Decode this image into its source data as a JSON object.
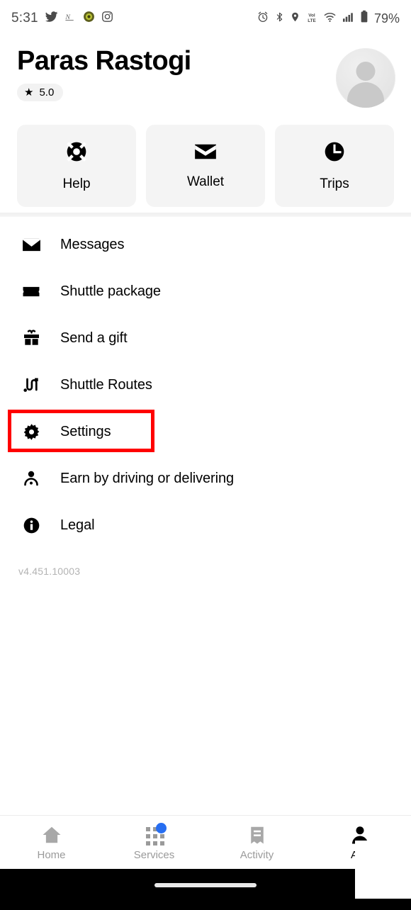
{
  "statusbar": {
    "time": "5:31",
    "battery_percent": "79%",
    "left_icons": [
      "twitter-icon",
      "news-icon",
      "app-badge-icon",
      "instagram-icon"
    ],
    "right_icons": [
      "alarm-icon",
      "bluetooth-icon",
      "location-icon",
      "volte-icon",
      "wifi-icon",
      "signal-icon",
      "battery-icon"
    ]
  },
  "header": {
    "username": "Paras Rastogi",
    "rating": "5.0",
    "rating_star": "★",
    "avatar_alt": "profile-avatar-placeholder"
  },
  "quick_actions": [
    {
      "label": "Help",
      "icon": "lifebuoy-icon"
    },
    {
      "label": "Wallet",
      "icon": "wallet-icon"
    },
    {
      "label": "Trips",
      "icon": "clock-icon"
    }
  ],
  "menu_items": [
    {
      "label": "Messages",
      "icon": "envelope-icon",
      "highlighted": false
    },
    {
      "label": "Shuttle package",
      "icon": "ticket-icon",
      "highlighted": false
    },
    {
      "label": "Send a gift",
      "icon": "gift-icon",
      "highlighted": false
    },
    {
      "label": "Shuttle Routes",
      "icon": "route-icon",
      "highlighted": false
    },
    {
      "label": "Settings",
      "icon": "gear-icon",
      "highlighted": true
    },
    {
      "label": "Earn by driving or delivering",
      "icon": "person-icon",
      "highlighted": false
    },
    {
      "label": "Legal",
      "icon": "info-icon",
      "highlighted": false
    }
  ],
  "version": "v4.451.10003",
  "bottom_nav": [
    {
      "label": "Home",
      "icon": "home-icon",
      "active": false,
      "badge": false
    },
    {
      "label": "Services",
      "icon": "grid-icon",
      "active": false,
      "badge": true
    },
    {
      "label": "Activity",
      "icon": "receipt-icon",
      "active": false,
      "badge": false
    },
    {
      "label": "Acc",
      "icon": "account-icon",
      "active": true,
      "badge": false
    }
  ],
  "annotation": {
    "type": "red-rectangle-highlight",
    "target": "Settings",
    "color": "#ff0000"
  },
  "colors": {
    "accent_blue": "#276ef1",
    "card_bg": "#f4f4f4",
    "badge_bg": "#f2f2f2",
    "muted_text": "#9a9a9a",
    "version_text": "#b3b3b3",
    "highlight": "#ff0000"
  }
}
